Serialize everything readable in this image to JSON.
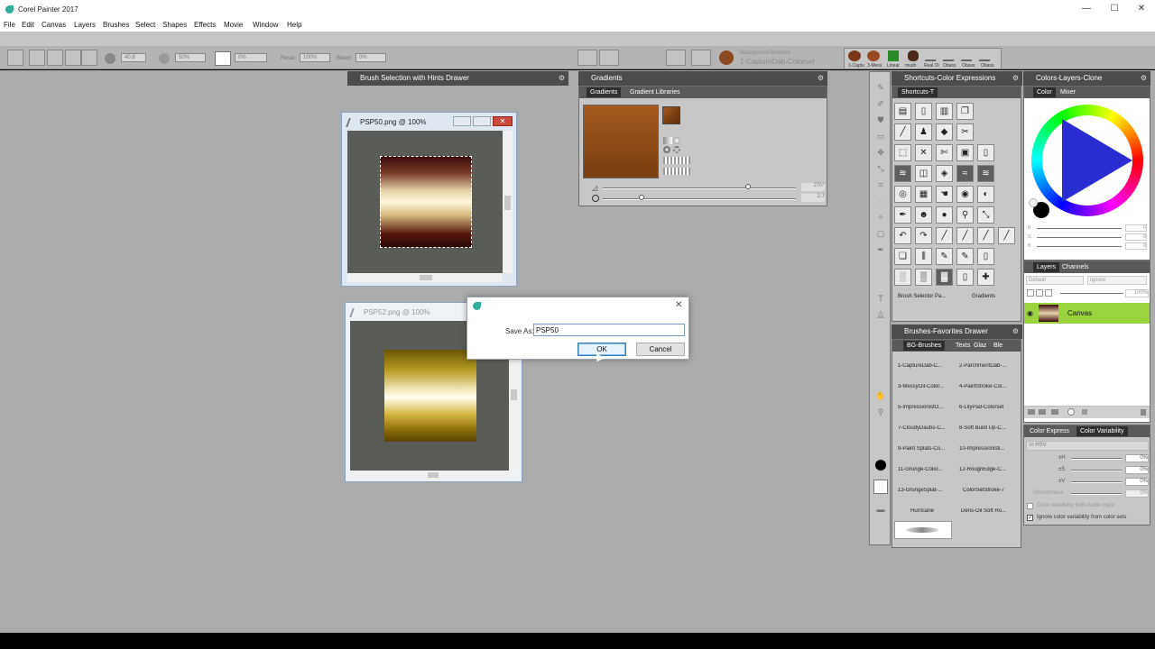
{
  "app": {
    "title": "Corel Painter 2017"
  },
  "window_controls": {
    "minimize": "—",
    "maximize": "☐",
    "close": "✕"
  },
  "menu": [
    "File",
    "Edit",
    "Canvas",
    "Layers",
    "Brushes",
    "Select",
    "Shapes",
    "Effects",
    "Movie",
    "Window",
    "Help"
  ],
  "property_bar": {
    "size_value": "40.8",
    "opacity_value": "50%",
    "grain_value": "0%",
    "resat_label": "Resat:",
    "resat_value": "100%",
    "bleed_label": "Bleed:",
    "bleed_value": "0%",
    "brush_category": "Background Brushes",
    "brush_variant": "1-CaptureDab-Colorset",
    "recent_brushes": [
      "1-Captu",
      "3-Mess",
      "Linear",
      "mush",
      "Real Oi",
      "Obass",
      "Obass",
      "Obass",
      "Obass"
    ]
  },
  "brush_selection_panel": {
    "title": "Brush Selection with Hints Drawer",
    "gear": "⚙"
  },
  "doc1": {
    "title": "PSP50.png @ 100%"
  },
  "doc2": {
    "title": "PSP52.png @ 100%"
  },
  "save_dialog": {
    "label": "Save As:",
    "value": "PSP50",
    "ok_label": "OK",
    "cancel_label": "Cancel",
    "close": "✕"
  },
  "gradients_panel": {
    "title": "Gradients",
    "tabs": [
      "Gradients",
      "Gradient Libraries"
    ],
    "angle_value": "270°",
    "spiral_value": "2.7",
    "gradient_colors": [
      "#a55a1e",
      "#7a3e10"
    ]
  },
  "shortcuts_panel": {
    "title": "Shortcuts-Color Expressions",
    "tab": "Shortcuts-T",
    "footer_left": "Brush Selector Pa...",
    "footer_right": "Gradients"
  },
  "brushes_favorites": {
    "title": "Brushes-Favorites Drawer",
    "tabs": [
      "BG-Brushes",
      "Texts",
      "Glaz",
      "Ble"
    ],
    "items": [
      "1-CaptureDab-C...",
      "2-ParchmentDab-...",
      "3-MessyOil-Color...",
      "4-PaintStroke-Col...",
      "5-ImpressionistO...",
      "6-LilyPad-Colorset",
      "7-CloudyDaubs-C...",
      "8-Soft Build Up-C...",
      "9-Paint Splats-Co...",
      "10-Impressionisti...",
      "11-Grunge-Color...",
      "12-RoughEdge-C...",
      "13-GrungeSplat-...",
      "ColorSetStroke-7",
      "Hurricane",
      "Dens-Oil Soft Ro..."
    ]
  },
  "colors_panel": {
    "title": "Colors-Layers-Clone",
    "tabs": [
      "Color",
      "Mixer"
    ],
    "r_value": "0",
    "g_value": "0",
    "b_value": "0",
    "r_label": "R",
    "g_label": "G",
    "b_label": "B"
  },
  "layers_panel": {
    "tabs": [
      "Layers",
      "Channels"
    ],
    "composite_method": "Default",
    "composite_depth": "Ignore",
    "opacity_value": "100%",
    "layer_name": "Canvas"
  },
  "color_expression_panel": {
    "tabs": [
      "Color Express",
      "Color Variability"
    ],
    "mode": "in HSV",
    "h_label": "±H",
    "s_label": "±S",
    "v_label": "±V",
    "h_value": "0%",
    "s_value": "0%",
    "v_value": "0%",
    "smoothness_label": "Smoothness",
    "smoothness_value": "0%",
    "option1": "Color variability from Audio input",
    "option2": "Ignore color variability from color sets"
  }
}
